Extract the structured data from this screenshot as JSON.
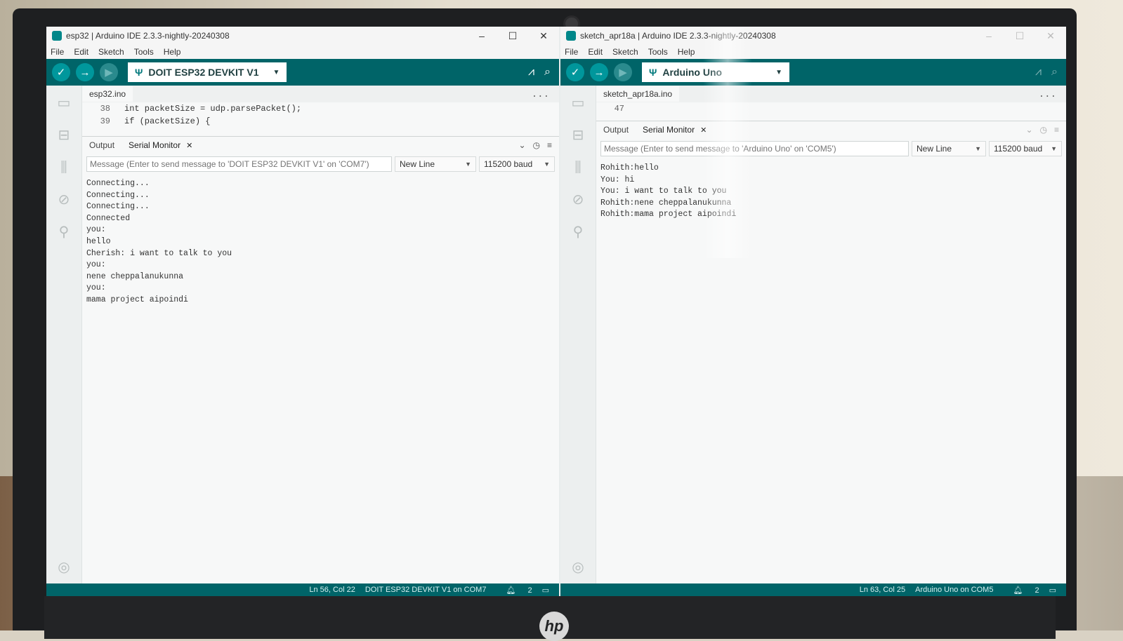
{
  "left": {
    "title": "esp32 | Arduino IDE 2.3.3-nightly-20240308",
    "menu": [
      "File",
      "Edit",
      "Sketch",
      "Tools",
      "Help"
    ],
    "board": "DOIT ESP32 DEVKIT V1",
    "file_tab": "esp32.ino",
    "code": [
      {
        "ln": "38",
        "text": "int packetSize = udp.parsePacket();"
      },
      {
        "ln": "39",
        "text": "if (packetSize) {"
      }
    ],
    "tabs": {
      "output": "Output",
      "serial": "Serial Monitor"
    },
    "message_placeholder": "Message (Enter to send message to 'DOIT ESP32 DEVKIT V1' on 'COM7')",
    "line_ending": "New Line",
    "baud": "115200 baud",
    "serial_lines": [
      "Connecting...",
      "Connecting...",
      "Connecting...",
      "Connected",
      "you:",
      "hello",
      "Cherish: i want to talk to you",
      "you:",
      "nene cheppalanukunna",
      "you:",
      "mama project aipoindi"
    ],
    "status": {
      "pos": "Ln 56, Col 22",
      "board": "DOIT ESP32 DEVKIT V1 on COM7",
      "notif": "2"
    }
  },
  "right": {
    "title": "sketch_apr18a | Arduino IDE 2.3.3-nightly-20240308",
    "menu": [
      "File",
      "Edit",
      "Sketch",
      "Tools",
      "Help"
    ],
    "board": "Arduino Uno",
    "file_tab": "sketch_apr18a.ino",
    "code": [
      {
        "ln": "47",
        "text": ""
      }
    ],
    "tabs": {
      "output": "Output",
      "serial": "Serial Monitor"
    },
    "message_placeholder": "Message (Enter to send message to 'Arduino Uno' on 'COM5')",
    "line_ending": "New Line",
    "baud": "115200 baud",
    "serial_lines": [
      "Rohith:hello",
      "You: hi",
      "You: i want to talk to you",
      "Rohith:nene cheppalanukunna",
      "Rohith:mama project aipoindi"
    ],
    "status": {
      "pos": "Ln 63, Col 25",
      "board": "Arduino Uno on COM5",
      "notif": "2"
    }
  },
  "laptop_brand": "hp"
}
